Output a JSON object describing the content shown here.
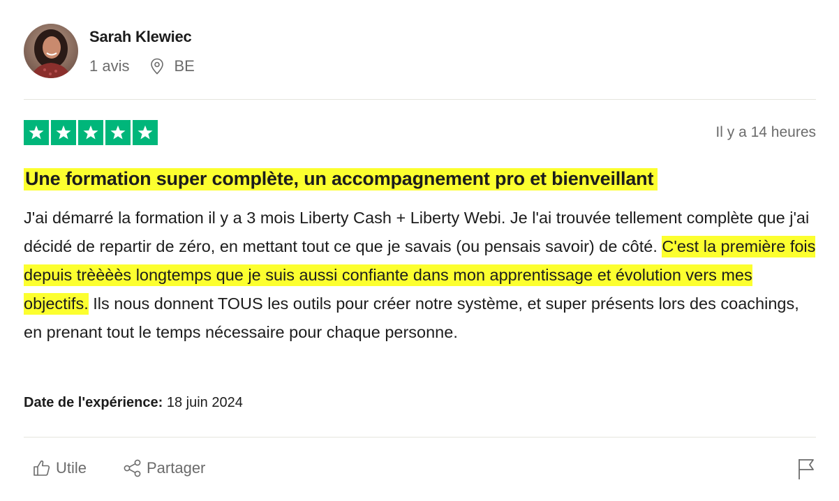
{
  "reviewer": {
    "name": "Sarah Klewiec",
    "reviews_count": "1 avis",
    "country": "BE"
  },
  "review": {
    "rating": 5,
    "rating_max": 5,
    "star_color": "#00b67a",
    "posted": "Il y a 14 heures",
    "title": "Une formation super complète, un accompagnement pro et bienveillant",
    "body_part1": "J'ai démarré la formation il y a 3 mois Liberty Cash + Liberty Webi. Je l'ai trouvée tellement complète que j'ai décidé de repartir de zéro, en mettant tout ce que je savais (ou pensais savoir) de côté. ",
    "body_highlight": "C'est la première fois depuis trèèèès longtemps que je suis aussi confiante dans mon apprentissage et évolution vers mes objectifs.",
    "body_part2": " Ils nous donnent TOUS les outils pour créer notre système, et super présents lors des coachings, en prenant tout le temps nécessaire pour chaque personne.",
    "highlight_color": "#fcff2f",
    "experience_label": "Date de l'expérience:",
    "experience_date": "18 juin 2024"
  },
  "actions": {
    "useful_label": "Utile",
    "share_label": "Partager"
  }
}
